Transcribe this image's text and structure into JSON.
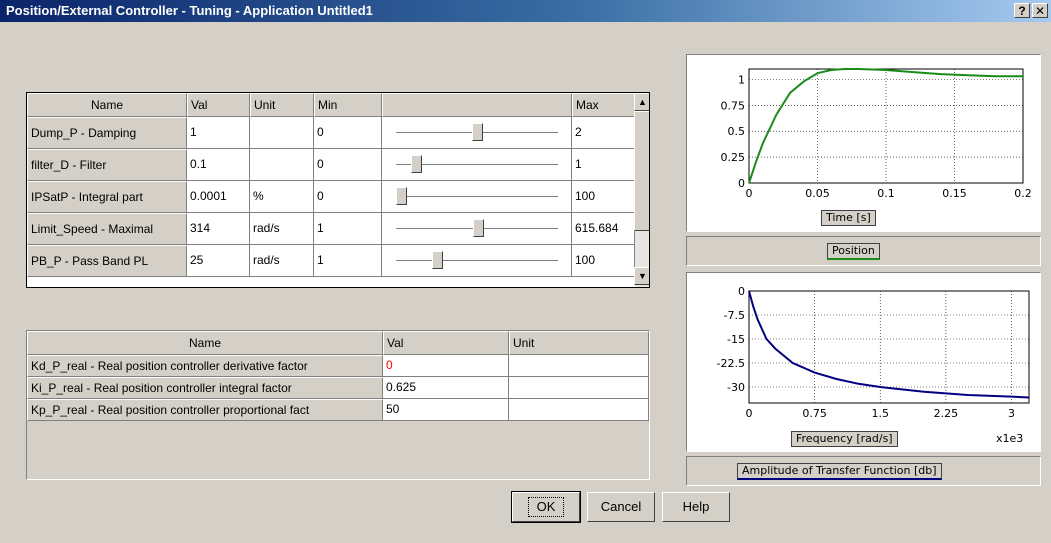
{
  "window": {
    "title": "Position/External Controller - Tuning - Application Untitled1",
    "help_label": "?",
    "close_label": "✕"
  },
  "param_table": {
    "headers": [
      "Name",
      "Val",
      "Unit",
      "Min",
      "",
      "Max"
    ],
    "rows": [
      {
        "name": "Dump_P - Damping",
        "val": "1",
        "unit": "",
        "min": "0",
        "max": "2",
        "slider_fraction": 0.5
      },
      {
        "name": "filter_D - Filter",
        "val": "0.1",
        "unit": "",
        "min": "0",
        "max": "1",
        "slider_fraction": 0.1
      },
      {
        "name": "IPSatP - Integral part",
        "val": "0.0001",
        "unit": "%",
        "min": "0",
        "max": "100",
        "slider_fraction": 0.0
      },
      {
        "name": "Limit_Speed - Maximal",
        "val": "314",
        "unit": "rad/s",
        "min": "1",
        "max": "615.684",
        "slider_fraction": 0.51
      },
      {
        "name": "PB_P - Pass Band PL",
        "val": "25",
        "unit": "rad/s",
        "min": "1",
        "max": "100",
        "slider_fraction": 0.24
      }
    ]
  },
  "result_table": {
    "headers": [
      "Name",
      "Val",
      "Unit"
    ],
    "rows": [
      {
        "name": "Kd_P_real - Real position controller derivative factor",
        "val": "0",
        "unit": "",
        "val_color": "#ff0000"
      },
      {
        "name": "Ki_P_real - Real position controller integral factor",
        "val": "0.625",
        "unit": ""
      },
      {
        "name": "Kp_P_real - Real position controller proportional fact",
        "val": "50",
        "unit": ""
      }
    ]
  },
  "charts": {
    "position": {
      "xlabel": "Time [s]",
      "legend": "Position",
      "color": "#1a8a1a",
      "xticks": [
        "0",
        "0.05",
        "0.1",
        "0.15",
        "0.2"
      ],
      "yticks": [
        "1",
        "0.75",
        "0.5",
        "0.25",
        "0"
      ]
    },
    "amplitude": {
      "xlabel": "Frequency [rad/s]",
      "x_multiplier": "x1e3",
      "legend": "Amplitude of Transfer Function [db]",
      "color": "#000080",
      "xticks": [
        "0",
        "0.75",
        "1.5",
        "2.25",
        "3"
      ],
      "yticks": [
        "0",
        "-7.5",
        "-15",
        "-22.5",
        "-30"
      ]
    }
  },
  "chart_data": [
    {
      "type": "line",
      "title": "",
      "xlabel": "Time [s]",
      "ylabel": "",
      "xlim": [
        0,
        0.2
      ],
      "ylim": [
        0,
        1.1
      ],
      "grid": true,
      "legend_position": "bottom",
      "series": [
        {
          "name": "Position",
          "x": [
            0,
            0.005,
            0.01,
            0.02,
            0.03,
            0.04,
            0.05,
            0.06,
            0.07,
            0.08,
            0.1,
            0.12,
            0.14,
            0.16,
            0.18,
            0.2
          ],
          "values": [
            0,
            0.2,
            0.38,
            0.66,
            0.87,
            0.98,
            1.06,
            1.09,
            1.1,
            1.1,
            1.09,
            1.07,
            1.05,
            1.04,
            1.03,
            1.03
          ]
        }
      ]
    },
    {
      "type": "line",
      "title": "",
      "xlabel": "Frequency [rad/s]",
      "ylabel": "",
      "x_multiplier": "x1e3",
      "xlim": [
        0,
        3.2
      ],
      "ylim": [
        -35,
        0
      ],
      "grid": true,
      "legend_position": "bottom",
      "series": [
        {
          "name": "Amplitude of Transfer Function [db]",
          "x": [
            0,
            0.05,
            0.1,
            0.2,
            0.3,
            0.5,
            0.75,
            1.0,
            1.25,
            1.5,
            2.0,
            2.5,
            3.0,
            3.2
          ],
          "values": [
            0,
            -5,
            -9,
            -15,
            -18,
            -22.5,
            -25.5,
            -27.5,
            -29,
            -30,
            -31.5,
            -32.5,
            -33,
            -33.3
          ]
        }
      ]
    }
  ],
  "buttons": {
    "ok": "OK",
    "cancel": "Cancel",
    "help": "Help"
  }
}
